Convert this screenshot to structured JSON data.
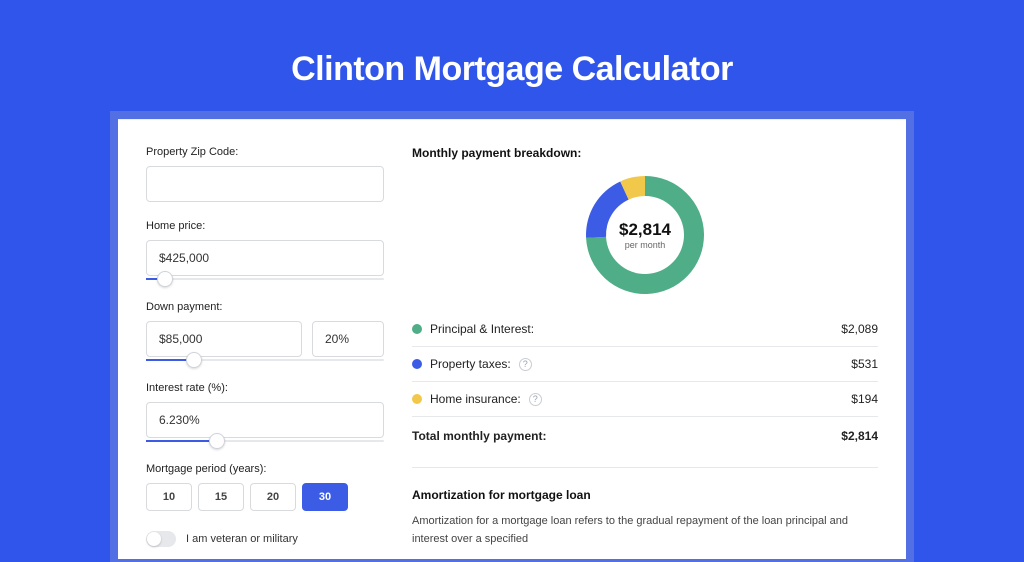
{
  "title": "Clinton Mortgage Calculator",
  "form": {
    "zip": {
      "label": "Property Zip Code:",
      "value": ""
    },
    "home_price": {
      "label": "Home price:",
      "value": "$425,000",
      "slider_percent": 8
    },
    "down_payment": {
      "label": "Down payment:",
      "value": "$85,000",
      "percent": "20%",
      "slider_percent": 20
    },
    "interest": {
      "label": "Interest rate (%):",
      "value": "6.230%",
      "slider_percent": 30
    },
    "period": {
      "label": "Mortgage period (years):",
      "options": [
        "10",
        "15",
        "20",
        "30"
      ],
      "selected": "30"
    },
    "veteran": {
      "label": "I am veteran or military",
      "on": false
    }
  },
  "breakdown": {
    "title": "Monthly payment breakdown:",
    "center_amount": "$2,814",
    "center_sub": "per month",
    "rows": [
      {
        "label": "Principal & Interest:",
        "value": "$2,089",
        "color": "green",
        "tooltip": false
      },
      {
        "label": "Property taxes:",
        "value": "$531",
        "color": "blue",
        "tooltip": true
      },
      {
        "label": "Home insurance:",
        "value": "$194",
        "color": "yellow",
        "tooltip": true
      }
    ],
    "total_label": "Total monthly payment:",
    "total_value": "$2,814"
  },
  "amort": {
    "title": "Amortization for mortgage loan",
    "body": "Amortization for a mortgage loan refers to the gradual repayment of the loan principal and interest over a specified"
  },
  "chart_data": {
    "type": "pie",
    "title": "Monthly payment breakdown",
    "series": [
      {
        "name": "Principal & Interest",
        "value": 2089,
        "color": "#4FAD88"
      },
      {
        "name": "Property taxes",
        "value": 531,
        "color": "#3C5CE6"
      },
      {
        "name": "Home insurance",
        "value": 194,
        "color": "#F2C84B"
      }
    ],
    "center_value": 2814,
    "center_label": "per month"
  }
}
